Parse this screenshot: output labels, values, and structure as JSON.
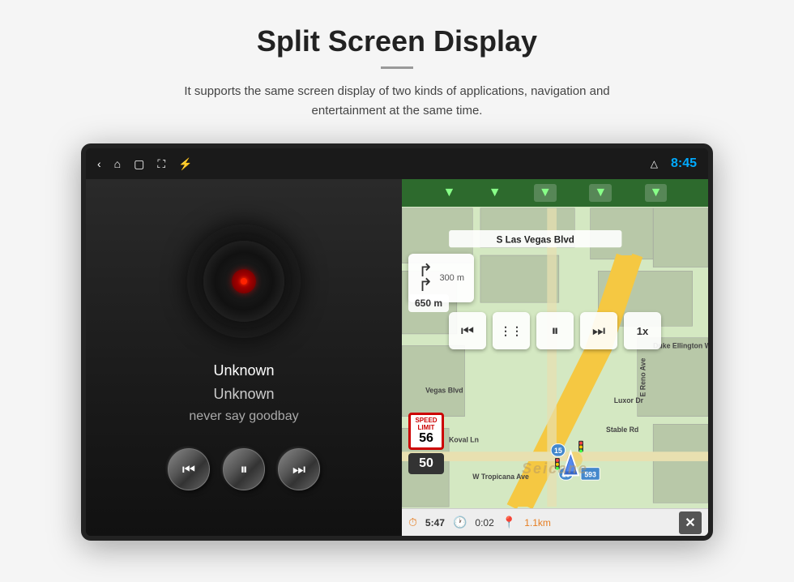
{
  "page": {
    "title": "Split Screen Display",
    "divider": "—",
    "subtitle": "It supports the same screen display of two kinds of applications, navigation and entertainment at the same time."
  },
  "status_bar": {
    "time": "8:45",
    "icons": [
      "back-icon",
      "home-icon",
      "window-icon",
      "photo-icon",
      "usb-icon",
      "triangle-icon"
    ]
  },
  "music_panel": {
    "track_title": "Unknown",
    "track_artist": "Unknown",
    "track_album": "never say goodbay",
    "controls": {
      "prev_label": "⏮",
      "play_pause_label": "⏸",
      "next_label": "⏭"
    }
  },
  "nav_panel": {
    "street_name": "S Las Vegas Blvd",
    "direction_label": "300 m",
    "dist_label": "650 m",
    "speed_limit": "56",
    "speed_current": "50",
    "road_labels": [
      "Koval Ln",
      "Duke Ellington Way",
      "Vegas Blvd",
      "Luxor Dr",
      "Stable Rd",
      "E Reno Ave",
      "W Tropicana Ave"
    ],
    "route_593": "593",
    "route_15": "15",
    "nav_controls": {
      "prev": "⏮",
      "chapters": "⋮⋮",
      "pause": "⏸",
      "next": "⏭",
      "speed": "1x"
    },
    "status_bar": {
      "eta": "5:47",
      "time_remaining": "0:02",
      "dist_remaining": "1.1km",
      "close": "✕"
    }
  },
  "watermark": "Seicane"
}
